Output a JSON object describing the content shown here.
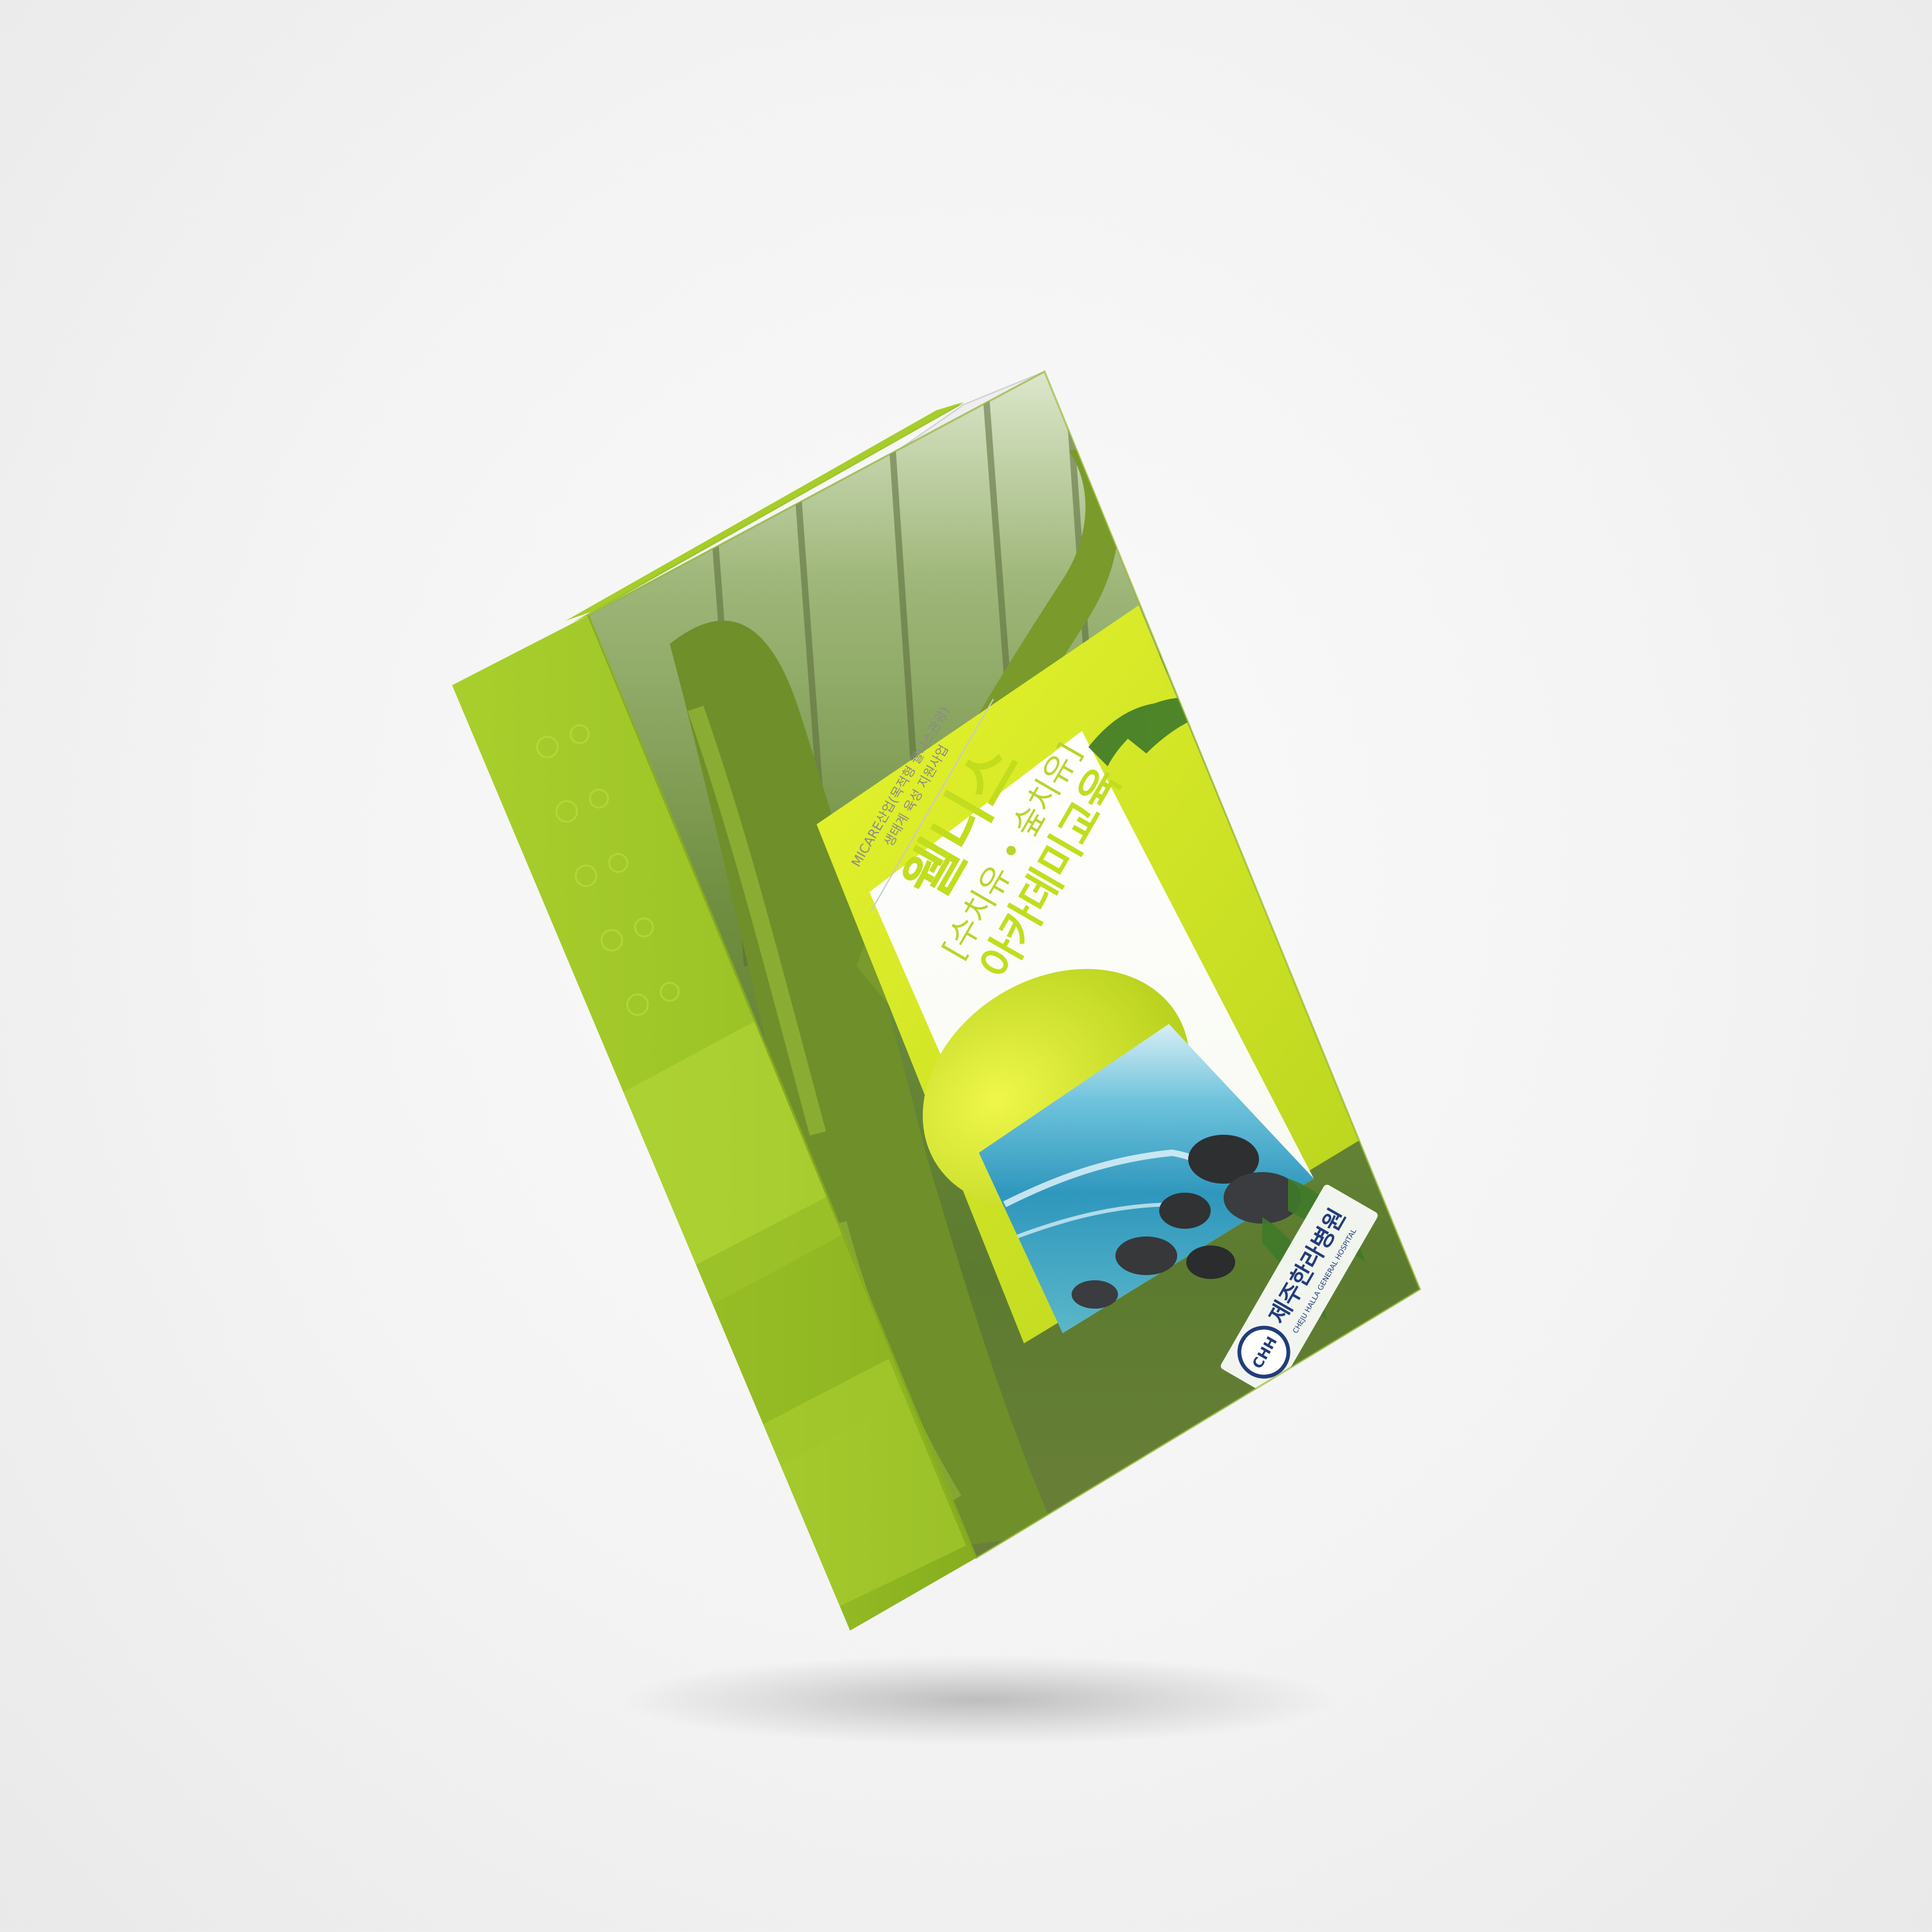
{
  "cover": {
    "supertitle_line1": "MICARE산업(목적형 웰니스관광)",
    "supertitle_line2": "생태계 육성 지원사업",
    "title_main": "웰니스",
    "title_sub": "[수치유 • 숲치유]",
    "title_program": "아카데미교육",
    "publisher_logo_text": "CHH",
    "publisher_name": "제주한라병원",
    "publisher_name_en": "CHEJU HALLA GENERAL HOSPITAL"
  },
  "colors": {
    "accent_lime": "#b5d42c",
    "title_lime": "#c2dd1e",
    "spine_green": "#9ac229",
    "forest_dark": "#4f6a2a",
    "ocean_blue": "#3aa3c4",
    "logo_navy": "#213c7a"
  }
}
